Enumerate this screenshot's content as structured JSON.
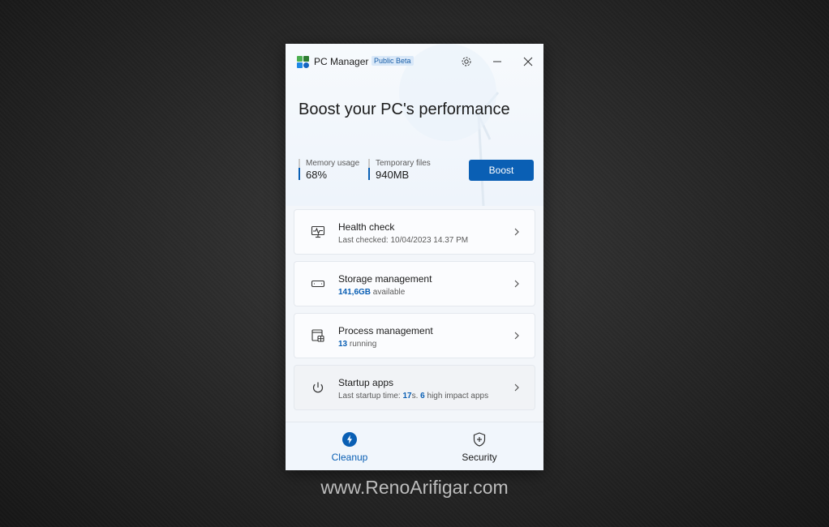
{
  "app": {
    "name": "PC Manager",
    "badge": "Public Beta",
    "controls": [
      "gear-icon",
      "minimize-icon",
      "close-icon"
    ]
  },
  "hero": {
    "headline": "Boost your PC's performance",
    "stats": [
      {
        "label": "Memory usage",
        "value": "68%"
      },
      {
        "label": "Temporary files",
        "value": "940MB"
      }
    ],
    "boost_label": "Boost"
  },
  "cards": [
    {
      "title": "Health check",
      "sub_pre": "Last checked: 10/04/2023 14.37 PM",
      "icon": "health-monitor-icon"
    },
    {
      "title": "Storage management",
      "highlight": "141,6GB",
      "sub_post": " available",
      "icon": "storage-drive-icon"
    },
    {
      "title": "Process management",
      "highlight": "13",
      "sub_post": " running",
      "icon": "process-window-icon"
    },
    {
      "title": "Startup apps",
      "sub_pre": "Last startup time: ",
      "highlight": "17",
      "mid": "s. ",
      "highlight2": "6",
      "sub_post": " high impact apps",
      "icon": "power-icon"
    }
  ],
  "nav": [
    {
      "label": "Cleanup",
      "icon": "lightning-icon",
      "active": true
    },
    {
      "label": "Security",
      "icon": "shield-plus-icon",
      "active": false
    }
  ],
  "colors": {
    "accent": "#0a5fb4"
  },
  "watermark": "www.RenoArifigar.com"
}
